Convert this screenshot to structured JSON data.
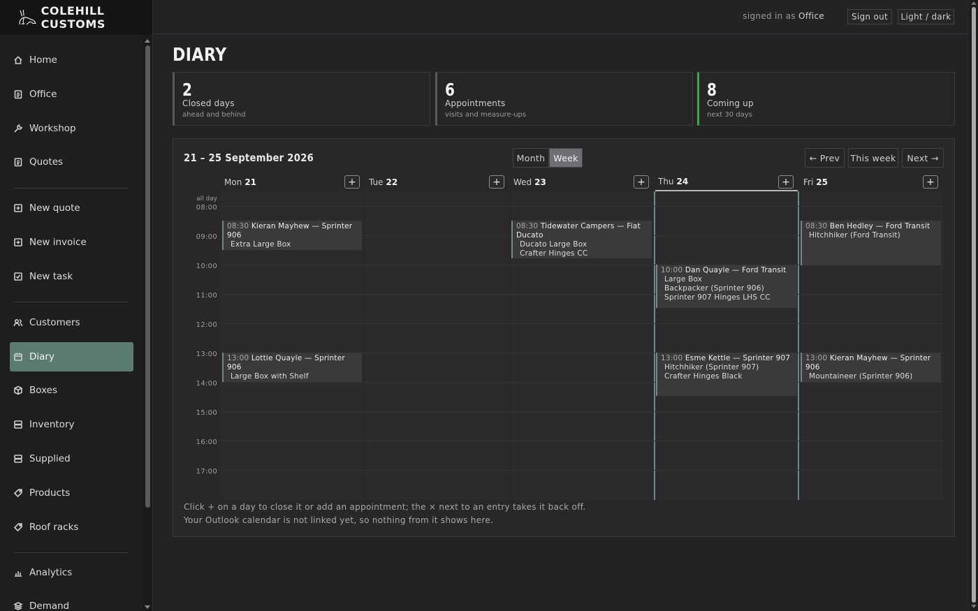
{
  "brand": {
    "name": "COLEHILL CUSTOMS"
  },
  "sidebar": {
    "items": [
      {
        "label": "Home",
        "icon": "home-icon"
      },
      {
        "label": "Office",
        "icon": "clipboard-icon"
      },
      {
        "label": "Workshop",
        "icon": "wrench-icon"
      },
      {
        "label": "Quotes",
        "icon": "document-icon"
      },
      {
        "label": "New quote",
        "icon": "plus-square-icon"
      },
      {
        "label": "New invoice",
        "icon": "plus-square-icon"
      },
      {
        "label": "New task",
        "icon": "checkbox-icon"
      },
      {
        "label": "Customers",
        "icon": "users-icon"
      },
      {
        "label": "Diary",
        "icon": "calendar-icon",
        "active": true
      },
      {
        "label": "Boxes",
        "icon": "box-icon"
      },
      {
        "label": "Inventory",
        "icon": "storage-icon"
      },
      {
        "label": "Supplied",
        "icon": "storage-icon"
      },
      {
        "label": "Products",
        "icon": "tag-icon"
      },
      {
        "label": "Roof racks",
        "icon": "tag-icon"
      },
      {
        "label": "Analytics",
        "icon": "bar-chart-icon"
      },
      {
        "label": "Demand",
        "icon": "layers-icon"
      }
    ]
  },
  "topbar": {
    "signed_prefix": "signed in as",
    "signed_user": "Office",
    "sign_out": "Sign out",
    "theme_toggle": "Light / dark"
  },
  "page": {
    "title": "DIARY"
  },
  "stats": [
    {
      "value": "2",
      "label": "Closed days",
      "sub": "ahead and behind"
    },
    {
      "value": "6",
      "label": "Appointments",
      "sub": "visits and measure-ups"
    },
    {
      "value": "8",
      "label": "Coming up",
      "sub": "next 30 days",
      "accent": "#3aa845"
    }
  ],
  "calendar": {
    "range": "21 – 25 September 2026",
    "views": {
      "month": "Month",
      "week": "Week",
      "selected": "Week"
    },
    "nav": {
      "prev": "← Prev",
      "this_week": "This week",
      "next": "Next →"
    },
    "add_label": "+",
    "all_day_label": "all day",
    "days": [
      {
        "name": "Mon",
        "date": "21"
      },
      {
        "name": "Tue",
        "date": "22"
      },
      {
        "name": "Wed",
        "date": "23"
      },
      {
        "name": "Thu",
        "date": "24",
        "today": true
      },
      {
        "name": "Fri",
        "date": "25"
      }
    ],
    "hours": [
      "08:00",
      "09:00",
      "10:00",
      "11:00",
      "12:00",
      "13:00",
      "14:00",
      "15:00",
      "16:00",
      "17:00"
    ],
    "events": [
      {
        "day": 0,
        "start": "08:30",
        "time": "08:30",
        "title": "Kieran Mayhew — Sprinter",
        "title2": "906",
        "lines": [
          "Extra Large Box"
        ]
      },
      {
        "day": 2,
        "start": "08:30",
        "time": "08:30",
        "title": "Tidewater Campers — Fiat",
        "title2": "Ducato",
        "lines": [
          "Ducato Large Box",
          "Crafter Hinges CC"
        ]
      },
      {
        "day": 4,
        "start": "08:30",
        "time": "08:30",
        "title": "Ben Hedley — Ford Transit",
        "title2": "",
        "lines": [
          "Hitchhiker (Ford Transit)"
        ]
      },
      {
        "day": 3,
        "start": "10:00",
        "time": "10:00",
        "title": "Dan Quayle — Ford Transit",
        "title2": "",
        "lines": [
          "Large Box",
          "Backpacker (Sprinter 906)",
          "Sprinter 907 Hinges LHS CC"
        ]
      },
      {
        "day": 0,
        "start": "13:00",
        "time": "13:00",
        "title": "Lottie Quayle — Sprinter 906",
        "title2": "",
        "lines": [
          "Large Box with Shelf"
        ]
      },
      {
        "day": 3,
        "start": "13:00",
        "time": "13:00",
        "title": "Esme Kettle — Sprinter 907",
        "title2": "",
        "lines": [
          "Hitchhiker (Sprinter 907)",
          "Crafter Hinges Black"
        ]
      },
      {
        "day": 4,
        "start": "13:00",
        "time": "13:00",
        "title": "Kieran Mayhew — Sprinter",
        "title2": "906",
        "lines": [
          "Mountaineer (Sprinter 906)"
        ]
      }
    ],
    "footnote": [
      "Click + on a day to close it or add an appointment; the × next to an entry takes it back off.",
      "Your Outlook calendar is not linked yet, so nothing from it shows here."
    ]
  }
}
